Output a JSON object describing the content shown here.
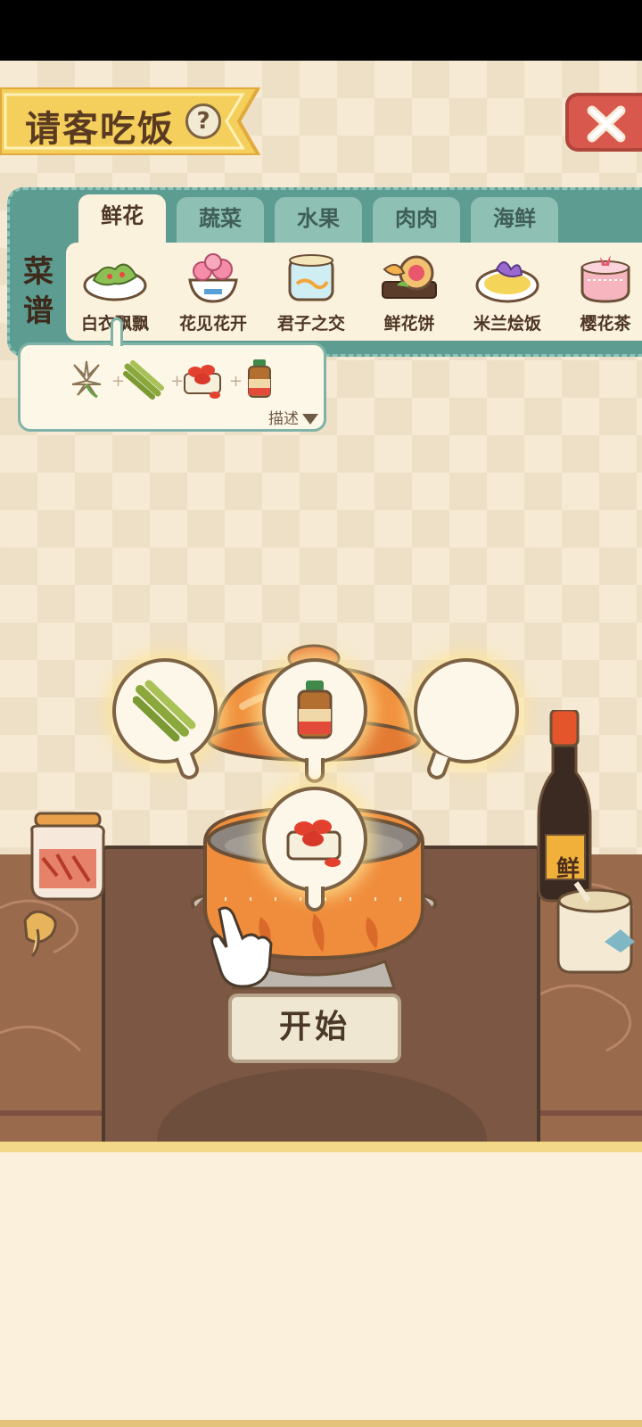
{
  "header": {
    "title": "请客吃饭",
    "help_icon": "help-icon",
    "close_icon": "close-icon"
  },
  "recipe": {
    "label_line1": "菜",
    "label_line2": "谱",
    "tabs": [
      {
        "label": "鲜花",
        "active": true
      },
      {
        "label": "蔬菜",
        "active": false
      },
      {
        "label": "水果",
        "active": false
      },
      {
        "label": "肉肉",
        "active": false
      },
      {
        "label": "海鲜",
        "active": false
      }
    ],
    "dishes": [
      {
        "name": "白衣飘飘",
        "icon": "salad-plate-icon"
      },
      {
        "name": "花见花开",
        "icon": "flower-bowl-icon"
      },
      {
        "name": "君子之交",
        "icon": "jelly-cake-icon"
      },
      {
        "name": "鲜花饼",
        "icon": "flower-pie-icon"
      },
      {
        "name": "米兰烩饭",
        "icon": "risotto-plate-icon"
      },
      {
        "name": "樱花茶",
        "icon": "sakura-tea-icon"
      }
    ]
  },
  "ingredients": {
    "items": [
      "lily-flower-icon",
      "asparagus-icon",
      "goji-berry-icon",
      "sauce-bottle-icon"
    ],
    "plus": "+",
    "desc_label": "描述"
  },
  "cooking": {
    "slots": [
      "asparagus-icon",
      "sauce-bottle-icon",
      "empty-slot",
      "goji-berry-icon"
    ],
    "start_label": "开始",
    "soy_sauce_label": "鲜"
  },
  "colors": {
    "panel_teal": "#5c9c91",
    "banner_yellow": "#f5cf5c",
    "close_red": "#d9584d",
    "pot_orange": "#e98a3c"
  }
}
